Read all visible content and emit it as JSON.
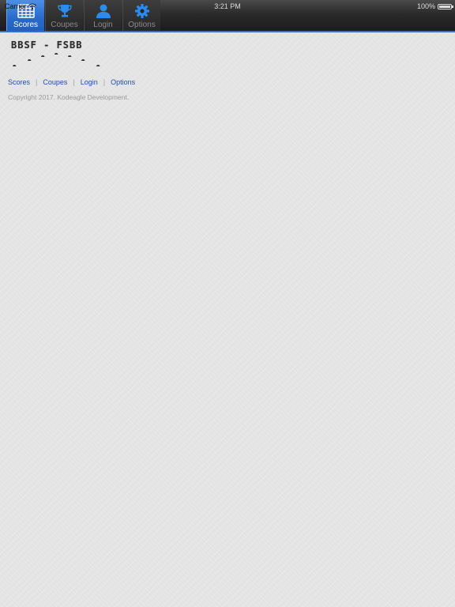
{
  "status": {
    "carrier": "Carrier",
    "time": "3:21 PM",
    "battery": "100%",
    "battery_level": 1.0
  },
  "tabs": [
    {
      "label": "Scores",
      "icon": "grid-icon",
      "active": true
    },
    {
      "label": "Coupes",
      "icon": "trophy-icon",
      "active": false
    },
    {
      "label": "Login",
      "icon": "user-icon",
      "active": false
    },
    {
      "label": "Options",
      "icon": "gear-icon",
      "active": false
    }
  ],
  "logo": {
    "text": "BBSF - FSBB"
  },
  "links": [
    "Scores",
    "Coupes",
    "Login",
    "Options"
  ],
  "footer": {
    "copyright": "Copyright 2017. Kodeagle Development."
  },
  "colors": {
    "accent": "#2a6ac9",
    "link": "#1f4fa8",
    "icon_blue": "#2a8cf0",
    "background": "#e7e7e7"
  }
}
